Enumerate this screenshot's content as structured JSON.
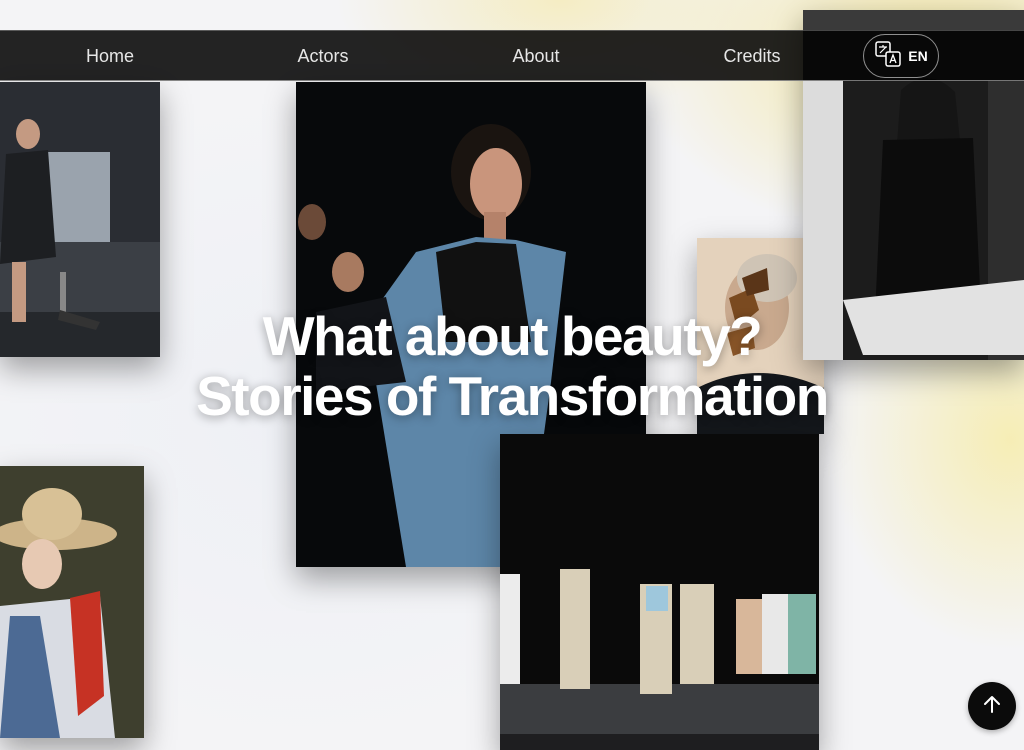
{
  "nav": {
    "items": [
      {
        "label": "Home"
      },
      {
        "label": "Actors"
      },
      {
        "label": "About"
      },
      {
        "label": "Credits"
      }
    ],
    "language": {
      "code": "EN",
      "icon": "translate-icon"
    }
  },
  "hero": {
    "line1": "What about beauty?",
    "line2": "Stories of Transformation"
  },
  "photos": [
    {
      "name": "runway-amputee-photo"
    },
    {
      "name": "center-portrait-photo"
    },
    {
      "name": "butterfly-mask-photo"
    },
    {
      "name": "bw-woman-photo"
    },
    {
      "name": "straw-hat-photo"
    },
    {
      "name": "runway-group-photo"
    }
  ],
  "back_to_top": {
    "icon": "arrow-up-icon"
  },
  "colors": {
    "nav_bg": "#000000",
    "accent_warm": "#f4e7a0"
  }
}
